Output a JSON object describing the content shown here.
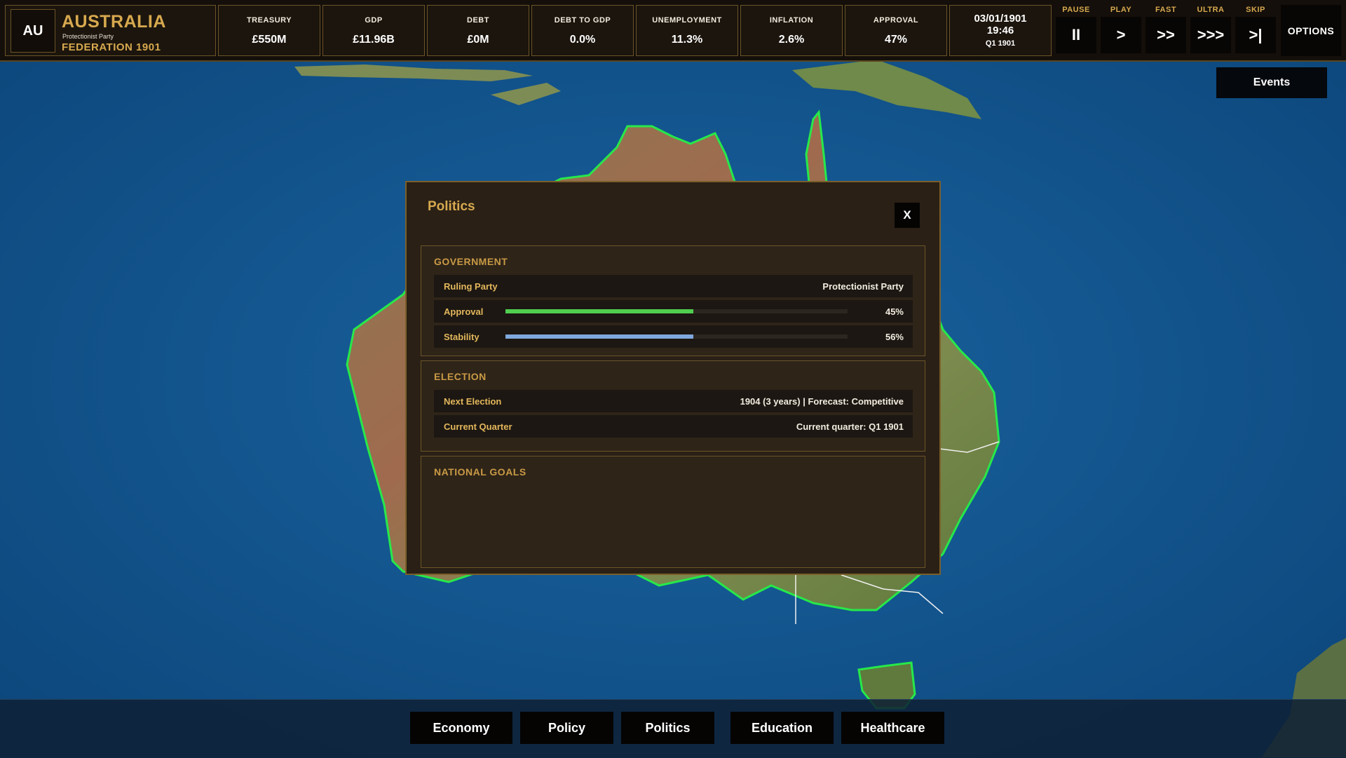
{
  "nation": {
    "code": "AU",
    "name": "AUSTRALIA",
    "party": "Protectionist Party",
    "subtitle": "FEDERATION 1901"
  },
  "stats": [
    {
      "label": "TREASURY",
      "value": "£550M"
    },
    {
      "label": "GDP",
      "value": "£11.96B"
    },
    {
      "label": "DEBT",
      "value": "£0M"
    },
    {
      "label": "DEBT TO GDP",
      "value": "0.0%"
    },
    {
      "label": "UNEMPLOYMENT",
      "value": "11.3%"
    },
    {
      "label": "INFLATION",
      "value": "2.6%"
    },
    {
      "label": "APPROVAL",
      "value": "47%"
    }
  ],
  "datetime": {
    "date": "03/01/1901",
    "time": "19:46",
    "quarter": "Q1 1901"
  },
  "speed_controls": [
    {
      "label": "PAUSE",
      "symbol": "II"
    },
    {
      "label": "PLAY",
      "symbol": ">"
    },
    {
      "label": "FAST",
      "symbol": ">>"
    },
    {
      "label": "ULTRA",
      "symbol": ">>>"
    },
    {
      "label": "SKIP",
      "symbol": ">|"
    }
  ],
  "options_label": "OPTIONS",
  "events_label": "Events",
  "politics_panel": {
    "title": "Politics",
    "close_label": "X",
    "government": {
      "title": "GOVERNMENT",
      "ruling_party_label": "Ruling Party",
      "ruling_party_value": "Protectionist Party",
      "approval_label": "Approval",
      "approval_value": "45%",
      "approval_fraction": 0.55,
      "stability_label": "Stability",
      "stability_value": "56%",
      "stability_fraction": 0.55
    },
    "election": {
      "title": "ELECTION",
      "next_election_label": "Next Election",
      "next_election_value": "1904 (3 years) | Forecast: Competitive",
      "current_quarter_label": "Current Quarter",
      "current_quarter_value": "Current quarter: Q1 1901"
    },
    "national_goals": {
      "title": "NATIONAL GOALS"
    }
  },
  "bottom_nav": [
    {
      "label": "Economy"
    },
    {
      "label": "Policy"
    },
    {
      "label": "Politics"
    },
    {
      "label": "Education"
    },
    {
      "label": "Healthcare"
    }
  ],
  "colors": {
    "accent_gold": "#d7a94f",
    "approval_bar": "#4fcf4f",
    "stability_bar": "#7fa8de",
    "map_ocean": "#0f4f86",
    "border_green": "#27e84a"
  }
}
